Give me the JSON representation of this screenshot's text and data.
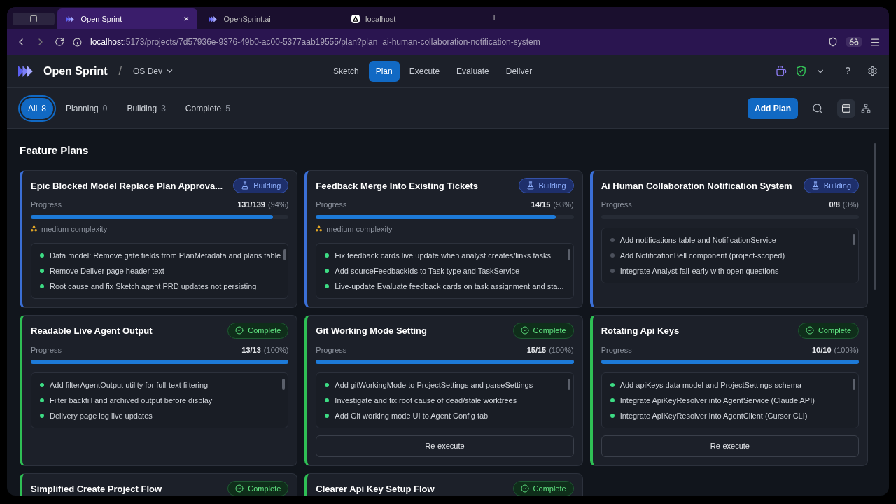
{
  "browser": {
    "tabs": [
      {
        "title": "Open Sprint",
        "selected": true,
        "kind": "sprint",
        "close": "×"
      },
      {
        "title": "OpenSprint.ai",
        "selected": false,
        "kind": "sprint"
      },
      {
        "title": "localhost",
        "selected": false,
        "kind": "triangle"
      }
    ],
    "new_tab": "+",
    "url_host": "localhost",
    "url_path": ":5173/projects/7d57936e-9376-49b0-ac00-5377aab19555/plan?plan=ai-human-collaboration-notification-system"
  },
  "header": {
    "app_name": "Open Sprint",
    "separator": "/",
    "project": "OS Dev",
    "nav": [
      {
        "label": "Sketch",
        "selected": false
      },
      {
        "label": "Plan",
        "selected": true
      },
      {
        "label": "Execute",
        "selected": false
      },
      {
        "label": "Evaluate",
        "selected": false
      },
      {
        "label": "Deliver",
        "selected": false
      }
    ],
    "help": "?"
  },
  "filters": [
    {
      "label": "All",
      "count": "8",
      "selected": true
    },
    {
      "label": "Planning",
      "count": "0",
      "selected": false
    },
    {
      "label": "Building",
      "count": "3",
      "selected": false
    },
    {
      "label": "Complete",
      "count": "5",
      "selected": false
    }
  ],
  "add_plan": "Add Plan",
  "view_modes": [
    {
      "kind": "cards",
      "selected": true
    },
    {
      "kind": "graph",
      "selected": false
    }
  ],
  "section_title": "Feature Plans",
  "plans": [
    {
      "title": "Epic Blocked Model Replace Plan Approva...",
      "kind": "building",
      "badge": "Building",
      "progress_label": "Progress",
      "count": "131/139",
      "percent": "(94%)",
      "level": 0.94,
      "complexity": "medium complexity",
      "tasks": [
        {
          "text": "Data model: Remove gate fields from PlanMetadata and plans table",
          "done": true
        },
        {
          "text": "Remove Deliver page header text",
          "done": true
        },
        {
          "text": "Root cause and fix Sketch agent PRD updates not persisting",
          "done": true
        }
      ]
    },
    {
      "title": "Feedback Merge Into Existing Tickets",
      "kind": "building",
      "badge": "Building",
      "progress_label": "Progress",
      "count": "14/15",
      "percent": "(93%)",
      "level": 0.93,
      "complexity": "medium complexity",
      "tasks": [
        {
          "text": "Fix feedback cards live update when analyst creates/links tasks",
          "done": true
        },
        {
          "text": "Add sourceFeedbackIds to Task type and TaskService",
          "done": true
        },
        {
          "text": "Live-update Evaluate feedback cards on task assignment and sta...",
          "done": true
        }
      ]
    },
    {
      "title": "Ai Human Collaboration Notification System",
      "kind": "building",
      "badge": "Building",
      "progress_label": "Progress",
      "count": "0/8",
      "percent": "(0%)",
      "level": 0,
      "tasks": [
        {
          "text": "Add notifications table and NotificationService",
          "done": false
        },
        {
          "text": "Add NotificationBell component (project-scoped)",
          "done": false
        },
        {
          "text": "Integrate Analyst fail-early with open questions",
          "done": false
        }
      ]
    },
    {
      "title": "Readable Live Agent Output",
      "kind": "complete",
      "badge": "Complete",
      "progress_label": "Progress",
      "count": "13/13",
      "percent": "(100%)",
      "level": 1,
      "tasks": [
        {
          "text": "Add filterAgentOutput utility for full-text filtering",
          "done": true
        },
        {
          "text": "Filter backfill and archived output before display",
          "done": true
        },
        {
          "text": "Delivery page log live updates",
          "done": true
        }
      ]
    },
    {
      "title": "Git Working Mode Setting",
      "kind": "complete",
      "badge": "Complete",
      "progress_label": "Progress",
      "count": "15/15",
      "percent": "(100%)",
      "level": 1,
      "tasks": [
        {
          "text": "Add gitWorkingMode to ProjectSettings and parseSettings",
          "done": true
        },
        {
          "text": "Investigate and fix root cause of dead/stale worktrees",
          "done": true
        },
        {
          "text": "Add Git working mode UI to Agent Config tab",
          "done": true
        }
      ],
      "action": "Re-execute"
    },
    {
      "title": "Rotating Api Keys",
      "kind": "complete",
      "badge": "Complete",
      "progress_label": "Progress",
      "count": "10/10",
      "percent": "(100%)",
      "level": 1,
      "tasks": [
        {
          "text": "Add apiKeys data model and ProjectSettings schema",
          "done": true
        },
        {
          "text": "Integrate ApiKeyResolver into AgentService (Claude API)",
          "done": true
        },
        {
          "text": "Integrate ApiKeyResolver into AgentClient (Cursor CLI)",
          "done": true
        }
      ],
      "action": "Re-execute"
    },
    {
      "title": "Simplified Create Project Flow",
      "kind": "complete",
      "badge": "Complete"
    },
    {
      "title": "Clearer Api Key Setup Flow",
      "kind": "complete",
      "badge": "Complete"
    }
  ]
}
